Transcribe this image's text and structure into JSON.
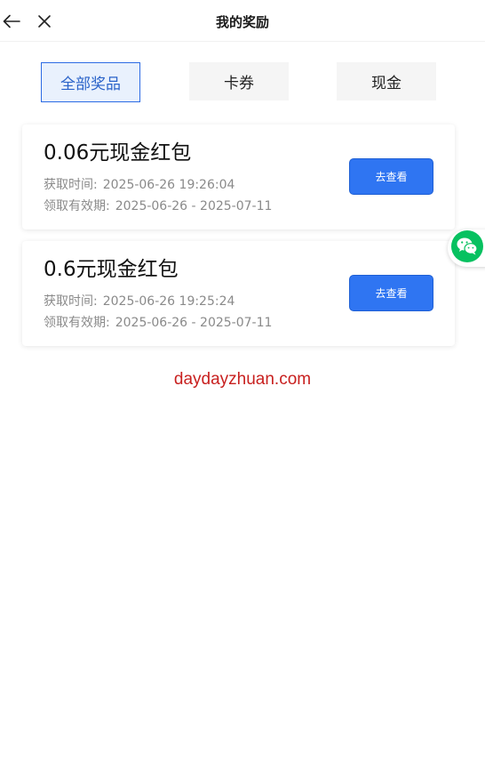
{
  "header": {
    "title": "我的奖励",
    "back_icon": "arrow-left-icon",
    "close_icon": "close-icon"
  },
  "tabs": [
    {
      "label": "全部奖品",
      "active": true
    },
    {
      "label": "卡券",
      "active": false
    },
    {
      "label": "现金",
      "active": false
    }
  ],
  "rewards": [
    {
      "title": "0.06元现金红包",
      "obtained_label": "获取时间:",
      "obtained_value": "2025-06-26 19:26:04",
      "valid_label": "领取有效期:",
      "valid_value": "2025-06-26 - 2025-07-11",
      "button_label": "去查看"
    },
    {
      "title": "0.6元现金红包",
      "obtained_label": "获取时间:",
      "obtained_value": "2025-06-26 19:25:24",
      "valid_label": "领取有效期:",
      "valid_value": "2025-06-26 - 2025-07-11",
      "button_label": "去查看"
    }
  ],
  "floating": {
    "icon": "wechat-icon"
  },
  "footer": {
    "site": "daydayzhuan.com"
  },
  "colors": {
    "accent": "#2f75f2",
    "active_tab_bg": "#e9f1fd",
    "active_tab_border": "#2c6be4",
    "site_link": "#c8201f",
    "wechat_green": "#07c160"
  }
}
